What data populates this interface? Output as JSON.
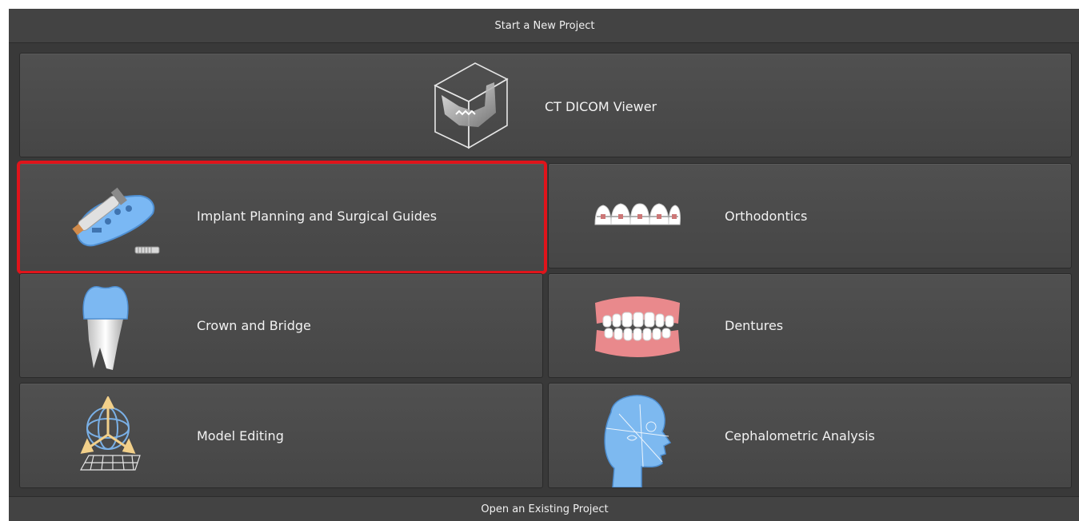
{
  "header": {
    "title": "Start a New Project"
  },
  "footer": {
    "title": "Open an Existing Project"
  },
  "tiles": {
    "ct_dicom": {
      "label": "CT DICOM Viewer",
      "icon": "jaw-cube-icon"
    },
    "implant": {
      "label": "Implant Planning and Surgical Guides",
      "icon": "implant-guide-icon",
      "selected": true
    },
    "orthodontics": {
      "label": "Orthodontics",
      "icon": "braces-icon"
    },
    "crown": {
      "label": "Crown and Bridge",
      "icon": "tooth-crown-icon"
    },
    "dentures": {
      "label": "Dentures",
      "icon": "dentures-icon"
    },
    "model_editing": {
      "label": "Model Editing",
      "icon": "transform-gizmo-icon"
    },
    "cephalometric": {
      "label": "Cephalometric Analysis",
      "icon": "head-xray-icon"
    }
  },
  "colors": {
    "background": "#393939",
    "tile": "#4b4b4b",
    "highlight": "#e0141b",
    "icon_blue": "#79b6f2"
  }
}
